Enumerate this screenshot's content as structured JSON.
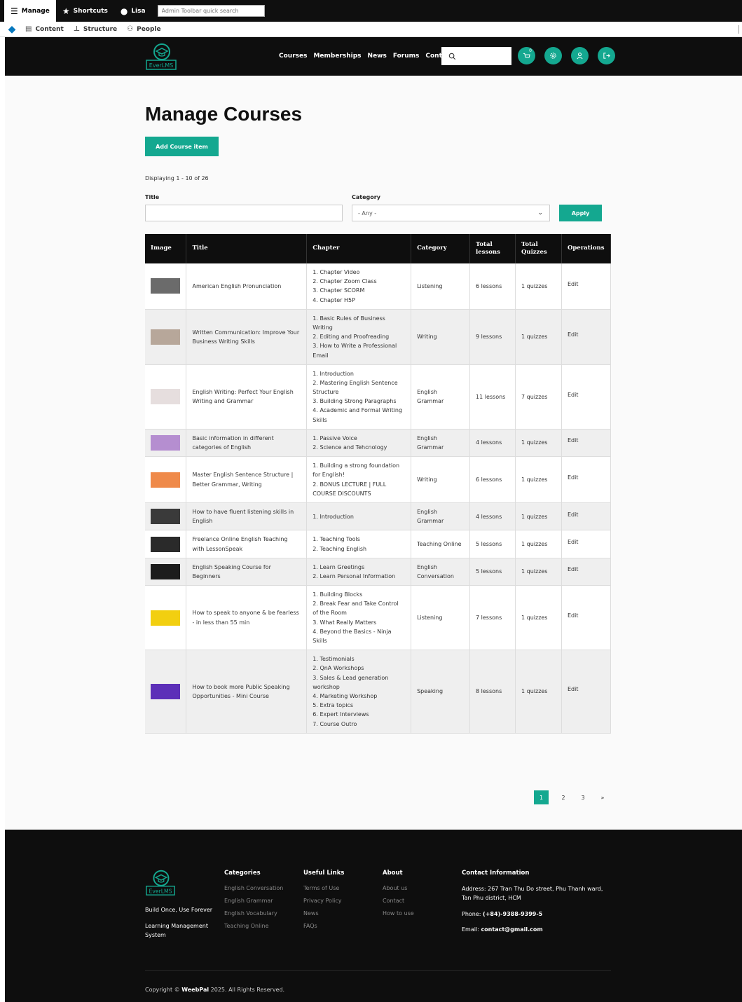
{
  "admin_toolbar": {
    "manage": "Manage",
    "shortcuts": "Shortcuts",
    "user": "Lisa",
    "search_placeholder": "Admin Toolbar quick search",
    "content": "Content",
    "structure": "Structure",
    "people": "People"
  },
  "header": {
    "logo_text": "EverLMS",
    "nav": [
      "Courses",
      "Memberships",
      "News",
      "Forums",
      "Contact Us"
    ],
    "cart_count": "0"
  },
  "main": {
    "title": "Manage Courses",
    "add_button": "Add Course item",
    "displaying": "Displaying 1 - 10 of 26",
    "filter_title_label": "Title",
    "filter_category_label": "Category",
    "filter_category_value": "- Any -",
    "apply_button": "Apply"
  },
  "table": {
    "headers": [
      "Image",
      "Title",
      "Chapter",
      "Category",
      "Total lessons",
      "Total Quizzes",
      "Operations"
    ],
    "rows": [
      {
        "title": "American English Pronunciation",
        "chapters": [
          "1. Chapter Video",
          "2. Chapter Zoom Class",
          "3. Chapter SCORM",
          "4. Chapter H5P"
        ],
        "category": "Listening",
        "lessons": "6 lessons",
        "quizzes": "1 quizzes",
        "op": "Edit",
        "thumb": "#6b6b6b"
      },
      {
        "title": "Written Communication: Improve Your Business Writing Skills",
        "chapters": [
          "1. Basic Rules of Business Writing",
          "2. Editing and Proofreading",
          "3. How to Write a Professional Email"
        ],
        "category": "Writing",
        "lessons": "9 lessons",
        "quizzes": "1 quizzes",
        "op": "Edit",
        "thumb": "#b7a79a"
      },
      {
        "title": "English Writing: Perfect Your English Writing and Grammar",
        "chapters": [
          "1. Introduction",
          "2. Mastering English Sentence Structure",
          "3. Building Strong Paragraphs",
          "4. Academic and Formal Writing Skills"
        ],
        "category": "English Grammar",
        "lessons": "11 lessons",
        "quizzes": "7 quizzes",
        "op": "Edit",
        "thumb": "#e6dede"
      },
      {
        "title": "Basic information in different categories of English",
        "chapters": [
          "1. Passive Voice",
          "2. Science and Tehcnology"
        ],
        "category": "English Grammar",
        "lessons": "4 lessons",
        "quizzes": "1 quizzes",
        "op": "Edit",
        "thumb": "#b58ed0"
      },
      {
        "title": "Master English Sentence Structure | Better Grammar, Writing",
        "chapters": [
          "1. Building a strong foundation for English!",
          "2. BONUS LECTURE | FULL COURSE DISCOUNTS"
        ],
        "category": "Writing",
        "lessons": "6 lessons",
        "quizzes": "1 quizzes",
        "op": "Edit",
        "thumb": "#ef8a4a"
      },
      {
        "title": "How to have fluent listening skills in English",
        "chapters": [
          "1. Introduction"
        ],
        "category": "English Grammar",
        "lessons": "4 lessons",
        "quizzes": "1 quizzes",
        "op": "Edit",
        "thumb": "#3a3a3a"
      },
      {
        "title": "Freelance Online English Teaching with LessonSpeak",
        "chapters": [
          "1. Teaching Tools",
          "2. Teaching English"
        ],
        "category": "Teaching Online",
        "lessons": "5 lessons",
        "quizzes": "1 quizzes",
        "op": "Edit",
        "thumb": "#2a2a2a"
      },
      {
        "title": "English Speaking Course for Beginners",
        "chapters": [
          "1. Learn Greetings",
          "2. Learn Personal Information"
        ],
        "category": "English Conversation",
        "lessons": "5 lessons",
        "quizzes": "1 quizzes",
        "op": "Edit",
        "thumb": "#1c1c1c"
      },
      {
        "title": "How to speak to anyone & be fearless - in less than 55 min",
        "chapters": [
          "1. Building Blocks",
          "2. Break Fear and Take Control of the Room",
          "3. What Really Matters",
          "4. Beyond the Basics - Ninja Skills"
        ],
        "category": "Listening",
        "lessons": "7 lessons",
        "quizzes": "1 quizzes",
        "op": "Edit",
        "thumb": "#f2cf10"
      },
      {
        "title": "How to book more Public Speaking Opportunities - Mini Course",
        "chapters": [
          "1. Testimonials",
          "2. QnA Workshops",
          "3. Sales & Lead generation workshop",
          "4. Marketing Workshop",
          "5. Extra topics",
          "6. Expert Interviews",
          "7. Course Outro"
        ],
        "category": "Speaking",
        "lessons": "8 lessons",
        "quizzes": "1 quizzes",
        "op": "Edit",
        "thumb": "#5c2fb8"
      }
    ]
  },
  "pager": {
    "current": "1",
    "p2": "2",
    "p3": "3",
    "next": "»"
  },
  "footer": {
    "logo_text": "EverLMS",
    "tagline": "Build Once, Use Forever",
    "tagline2": "Learning Management System",
    "categories_title": "Categories",
    "categories": [
      "English Conversation",
      "English Grammar",
      "English Vocabulary",
      "Teaching Online"
    ],
    "links_title": "Useful Links",
    "links": [
      "Terms of Use",
      "Privacy Policy",
      "News",
      "FAQs"
    ],
    "about_title": "About",
    "about": [
      "About us",
      "Contact",
      "How to use"
    ],
    "contact_title": "Contact Information",
    "address_label": "Address: ",
    "address": "267 Tran Thu Do street, Phu Thanh ward, Tan Phu district, HCM",
    "phone_label": "Phone: ",
    "phone": "(+84)-9388-9399-5",
    "email_label": "Email: ",
    "email": "contact@gmail.com",
    "copyright_pre": "Copyright © ",
    "copyright_brand": "WeebPal",
    "copyright_post": " 2025. All Rights Reserved."
  },
  "colors": {
    "accent": "#14a890",
    "dark": "#0e0e0e"
  }
}
